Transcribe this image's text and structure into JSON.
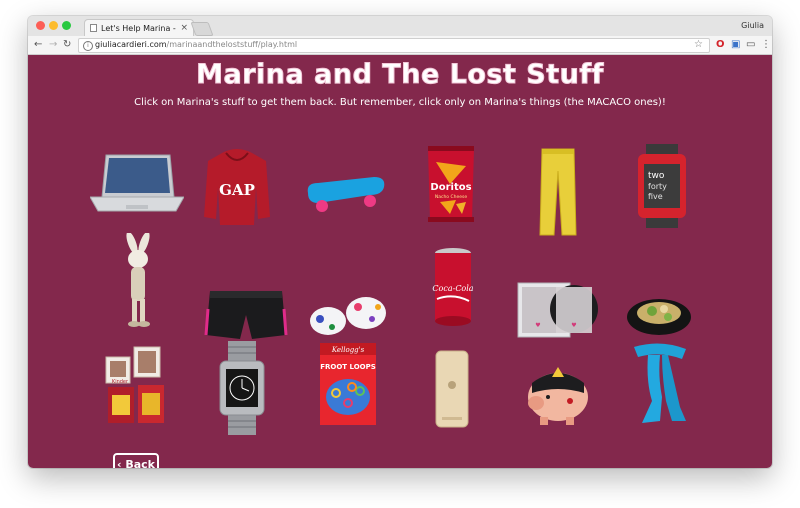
{
  "browser": {
    "tab_title": "Let's Help Marina - Marina And",
    "tab_close": "×",
    "profile_name": "Giulia",
    "url_host": "giuliacardieri.com",
    "url_path": "/marinaandtheloststuff/play.html"
  },
  "page": {
    "title": "Marina and The Lost Stuff",
    "subtitle": "Click on Marina's stuff to get them back. But remember, click only on Marina's things (the MACACO ones)!",
    "back_label": "‹ Back",
    "background_color": "#83284c"
  },
  "items": [
    {
      "name": "laptop"
    },
    {
      "name": "red-gap-hoodie",
      "text": "GAP"
    },
    {
      "name": "blue-skateboard"
    },
    {
      "name": "doritos-bag",
      "text": "Doritos",
      "subtext": "Nacho Cheese"
    },
    {
      "name": "yellow-pants"
    },
    {
      "name": "pebble-watch",
      "text": "two forty five"
    },
    {
      "name": "rabbit-figure"
    },
    {
      "name": "black-shorts"
    },
    {
      "name": "ring-pop-candies"
    },
    {
      "name": "coca-cola-can",
      "text": "Coca-Cola"
    },
    {
      "name": "britney-cd"
    },
    {
      "name": "salad-bowl"
    },
    {
      "name": "chocolate-boxes",
      "text": "Kinder"
    },
    {
      "name": "pebble-steel-watch"
    },
    {
      "name": "froot-loops-box",
      "text": "FROOT LOOPS",
      "brand": "Kellogg's"
    },
    {
      "name": "gold-iphone"
    },
    {
      "name": "wonder-woman-piggy-bank"
    },
    {
      "name": "blue-scarf"
    }
  ]
}
